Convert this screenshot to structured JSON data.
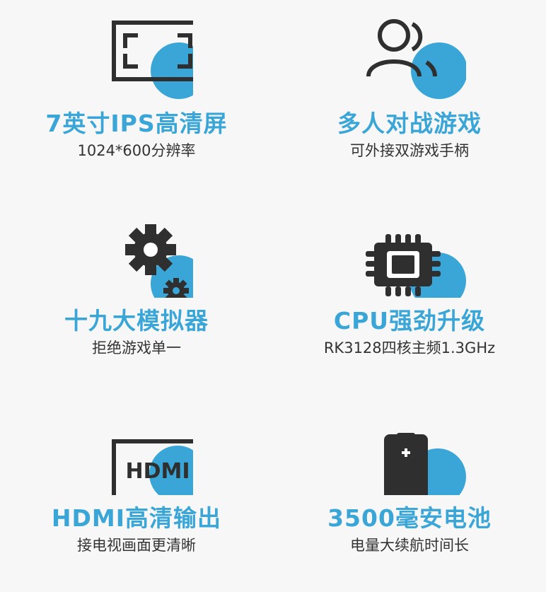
{
  "colors": {
    "accent": "#3aa6d8",
    "icon": "#2f2f2f",
    "title": "#3aa6d8",
    "subtitle": "#333333",
    "background": "#f7f7f7"
  },
  "features": [
    {
      "icon": "screen-icon",
      "title": "7英寸IPS高清屏",
      "subtitle": "1024*600分辨率"
    },
    {
      "icon": "users-icon",
      "title": "多人对战游戏",
      "subtitle": "可外接双游戏手柄"
    },
    {
      "icon": "gears-icon",
      "title": "十九大模拟器",
      "subtitle": "拒绝游戏单一"
    },
    {
      "icon": "cpu-icon",
      "title": "CPU强劲升级",
      "subtitle": "RK3128四核主频1.3GHz"
    },
    {
      "icon": "hdmi-icon",
      "icon_text": "HDMI",
      "title": "HDMI高清输出",
      "subtitle": "接电视画面更清晰"
    },
    {
      "icon": "battery-icon",
      "title": "3500毫安电池",
      "subtitle": "电量大续航时间长"
    }
  ]
}
